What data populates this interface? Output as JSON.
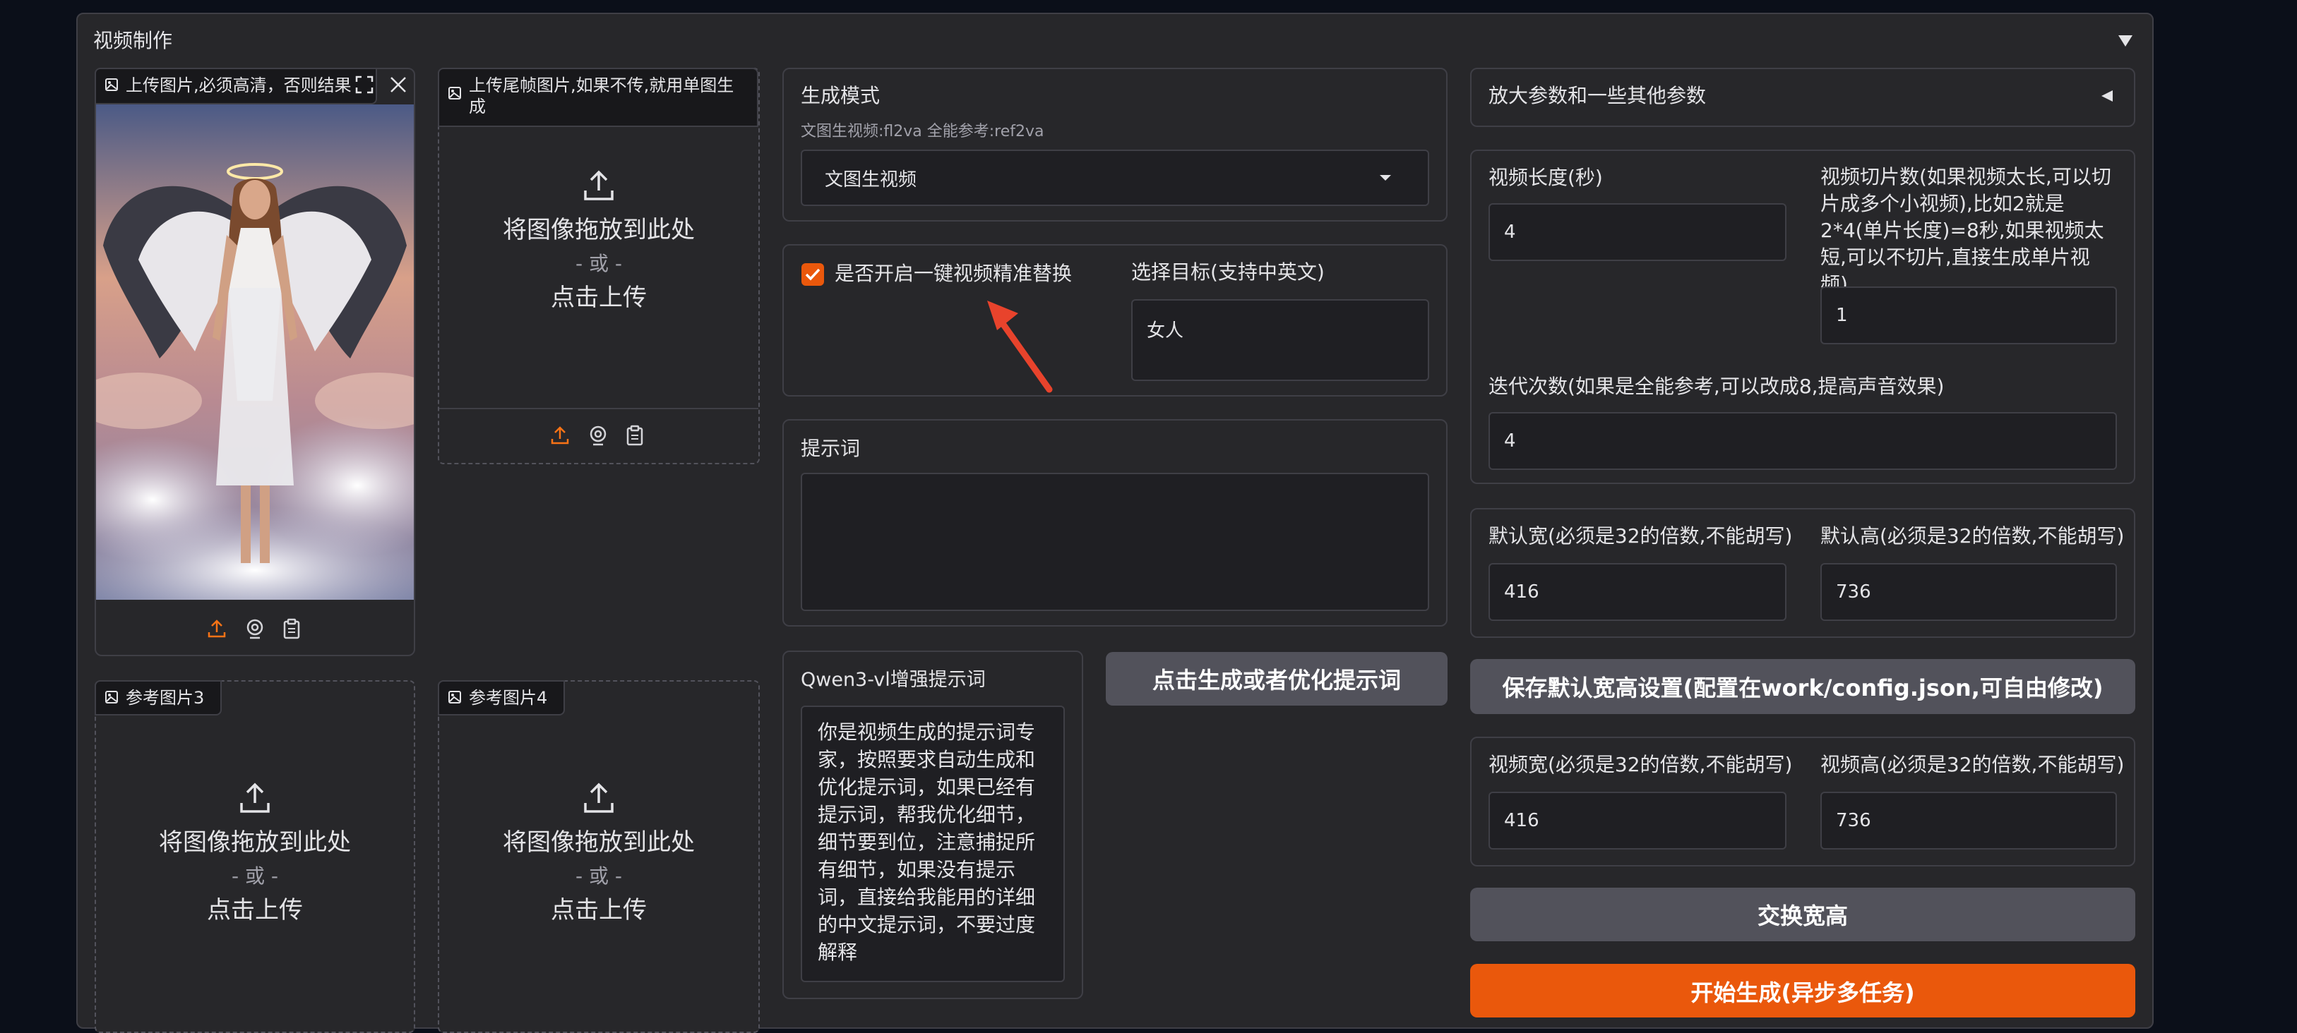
{
  "section": {
    "title": "视频制作",
    "collapse_icon": "triangle-down-icon"
  },
  "upload": {
    "image1_label": "上传图片,必须高清，否则结果",
    "image2_label": "上传尾帧图片,如果不传,就用单图生成",
    "image3_label": "参考图片3",
    "image4_label": "参考图片4",
    "drop_text": "将图像拖放到此处",
    "or_text": "- 或 -",
    "click_text": "点击上传"
  },
  "mode": {
    "label": "生成模式",
    "hint": "文图生视频:fl2va 全能参考:ref2va",
    "selected": "文图生视频"
  },
  "replace": {
    "checkbox_label": "是否开启一键视频精准替换",
    "checked": true,
    "target_label": "选择目标(支持中英文)",
    "target_value": "女人"
  },
  "prompt": {
    "label": "提示词",
    "value": ""
  },
  "qwen": {
    "label": "Qwen3-vl增强提示词",
    "text": "你是视频生成的提示词专家，按照要求自动生成和优化提示词，如果已经有提示词，帮我优化细节，细节要到位，注意捕捉所有细节，如果没有提示词，直接给我能用的详细的中文提示词，不要过度解释",
    "generate_button": "点击生成或者优化提示词"
  },
  "params": {
    "accordion_title": "放大参数和一些其他参数",
    "video_length_label": "视频长度(秒)",
    "video_length_value": "4",
    "slices_label": "视频切片数(如果视频太长,可以切片成多个小视频),比如2就是2*4(单片长度)=8秒,如果视频太短,可以不切片,直接生成单片视频)",
    "slices_value": "1",
    "iterations_label": "迭代次数(如果是全能参考,可以改成8,提高声音效果)",
    "iterations_value": "4",
    "default_width_label": "默认宽(必须是32的倍数,不能胡写)",
    "default_width_value": "416",
    "default_height_label": "默认高(必须是32的倍数,不能胡写)",
    "default_height_value": "736",
    "save_button": "保存默认宽高设置(配置在work/config.json,可自由修改)",
    "video_width_label": "视频宽(必须是32的倍数,不能胡写)",
    "video_width_value": "416",
    "video_height_label": "视频高(必须是32的倍数,不能胡写)",
    "video_height_value": "736",
    "swap_button": "交换宽高",
    "start_button": "开始生成(异步多任务)"
  },
  "colors": {
    "accent": "#ea580c",
    "panel": "#27272a",
    "border": "#3f3f46",
    "background": "#0b0f19"
  }
}
